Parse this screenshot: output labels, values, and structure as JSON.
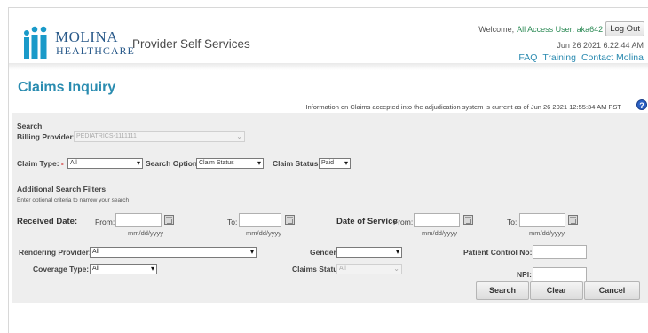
{
  "header": {
    "logo_line1": "MOLINA",
    "logo_line2": "HEALTHCARE",
    "app_name": "Provider Self Services",
    "welcome_prefix": "Welcome,",
    "welcome_user": "All Access User: aka642",
    "logout_label": "Log Out",
    "datetime": "Jun 26 2021 6:22:44 AM",
    "links": [
      "FAQ",
      "Training",
      "Contact Molina"
    ]
  },
  "page": {
    "title": "Claims Inquiry",
    "info": "Information on Claims accepted into the adjudication system is current as of Jun 26 2021 12:55:34 AM PST",
    "help_icon": "question-icon"
  },
  "search": {
    "section_label": "Search",
    "billing_provider_label": "Billing Provider:",
    "billing_provider_value": "PEDIATRICS-1111111",
    "claim_type_label": "Claim Type:",
    "claim_type_value": "All",
    "search_options_label": "Search Options:",
    "search_options_value": "Claim Status",
    "claim_status_label": "Claim Status:",
    "claim_status_value": "Paid",
    "required_mark": "*"
  },
  "filters": {
    "title": "Additional Search Filters",
    "hint": "Enter optional criteria to narrow your search",
    "received_date_label": "Received Date:",
    "from_label": "From:",
    "to_label": "To:",
    "date_format": "mm/dd/yyyy",
    "date_of_service_label": "Date of Service",
    "rendering_provider_label": "Rendering Provider:",
    "rendering_provider_value": "All",
    "gender_label": "Gender:",
    "gender_value": "",
    "patient_control_label": "Patient Control No:",
    "coverage_type_label": "Coverage Type:",
    "coverage_type_value": "All",
    "claims_status_label": "Claims Status:",
    "claims_status_value": "All",
    "npi_label": "NPI:"
  },
  "buttons": {
    "search": "Search",
    "clear": "Clear",
    "cancel": "Cancel"
  },
  "colors": {
    "accent": "#2a8cb0",
    "brand": "#2a5a8a",
    "panel_bg": "#eeeeee",
    "required": "#cc0000"
  }
}
